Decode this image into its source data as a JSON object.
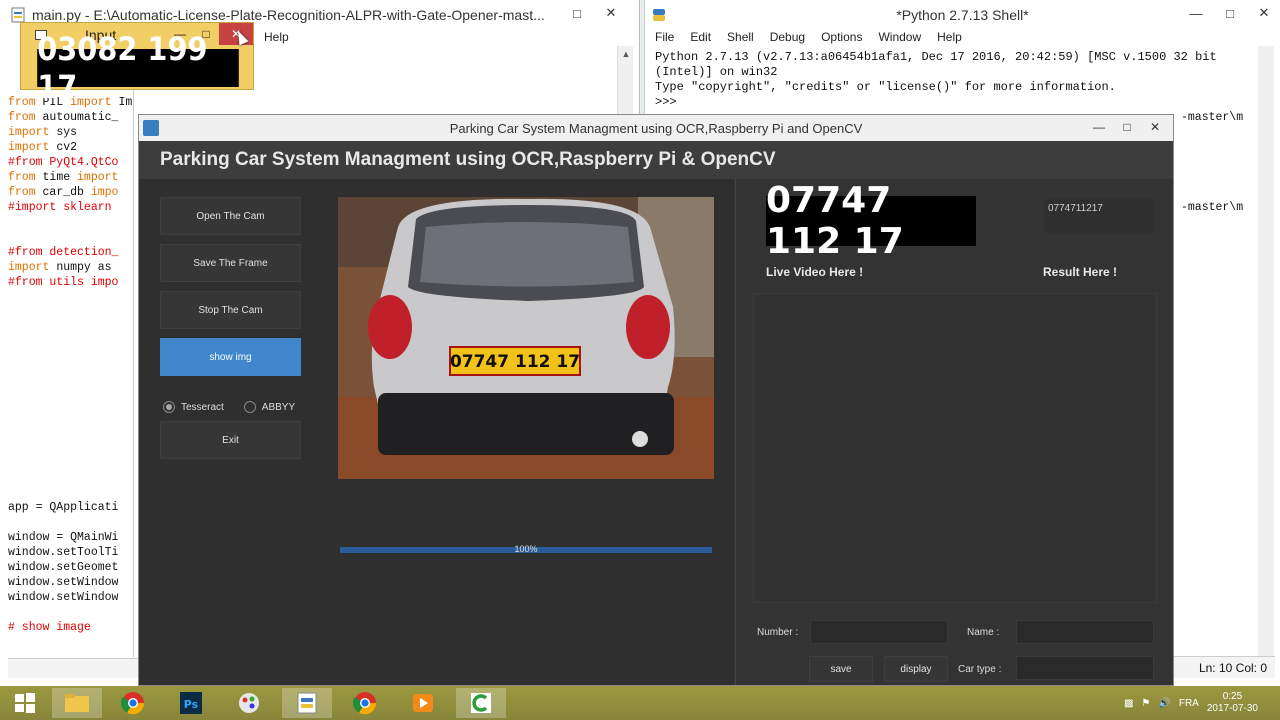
{
  "editor": {
    "title": "main.py - E:\\Automatic-License-Plate-Recognition-ALPR-with-Gate-Opener-mast...",
    "menu_help": "Help",
    "code_lines": [
      {
        "k": "from",
        "t": " PIL ",
        "k2": "import",
        "t2": " Image"
      },
      {
        "k": "from",
        "t": " autoumatic_",
        "k2": "",
        "t2": ""
      },
      {
        "k": "import",
        "t": " sys",
        "k2": "",
        "t2": ""
      },
      {
        "k": "import",
        "t": " cv2",
        "k2": "",
        "t2": ""
      },
      {
        "c": "#from PyQt4.QtCo"
      },
      {
        "k": "from",
        "t": " time ",
        "k2": "import",
        "t2": ""
      },
      {
        "k": "from",
        "t": " car_db ",
        "k2": "impo",
        "t2": ""
      },
      {
        "c": "#import sklearn"
      }
    ],
    "code_lines_2": [
      {
        "c": "#from detection_"
      },
      {
        "k": "import",
        "t": " numpy as",
        "k2": "",
        "t2": ""
      },
      {
        "c": "#from utils impo"
      }
    ],
    "code_lines_3": [
      "app = QApplicati",
      "",
      "window = QMainWi",
      "window.setToolTi",
      "window.setGeomet",
      "window.setWindow",
      "window.setWindow"
    ],
    "code_comment_last": "# show image"
  },
  "shell": {
    "title": "*Python 2.7.13 Shell*",
    "menu": [
      "File",
      "Edit",
      "Shell",
      "Debug",
      "Options",
      "Window",
      "Help"
    ],
    "lines": [
      "Python 2.7.13 (v2.7.13:a06454b1afa1, Dec 17 2016, 20:42:59) [MSC v.1500 32 bit",
      "(Intel)] on win32",
      "Type \"copyright\", \"credits\" or \"license()\" for more information.",
      ">>> "
    ],
    "side_text_1": "-master\\m",
    "side_text_2": "-master\\m",
    "status": "Ln: 10  Col: 0"
  },
  "input_window": {
    "title": "Input",
    "plate_text": "03082  199  17"
  },
  "app": {
    "window_title": "Parking Car System Managment using OCR,Raspberry Pi and OpenCV",
    "header": "Parking Car System Managment using OCR,Raspberry Pi & OpenCV",
    "buttons": {
      "open_cam": "Open The Cam",
      "save_frame": "Save The Frame",
      "stop_cam": "Stop The Cam",
      "show_img": "show img",
      "exit": "Exit"
    },
    "ocr_options": [
      "Tesseract",
      "ABBYY"
    ],
    "ocr_selected": "Tesseract",
    "progress": {
      "value": 100,
      "label": "100%"
    },
    "photo_plate": "07747 112 17",
    "plate_crop": "07747 112 17",
    "result_value": "0774711217",
    "live_label": "Live Video Here !",
    "result_label": "Result Here !",
    "number_label": "Number :",
    "name_label": "Name :",
    "car_type_label": "Car type :",
    "save_label": "save",
    "display_label": "display"
  },
  "taskbar": {
    "lang": "FRA",
    "time": "0:25",
    "date": "2017-07-30"
  },
  "colors": {
    "app_bg": "#323232",
    "accent_button": "#3f86cc",
    "taskbar": "#8f8f3a",
    "input_window": "#f2cf66"
  }
}
